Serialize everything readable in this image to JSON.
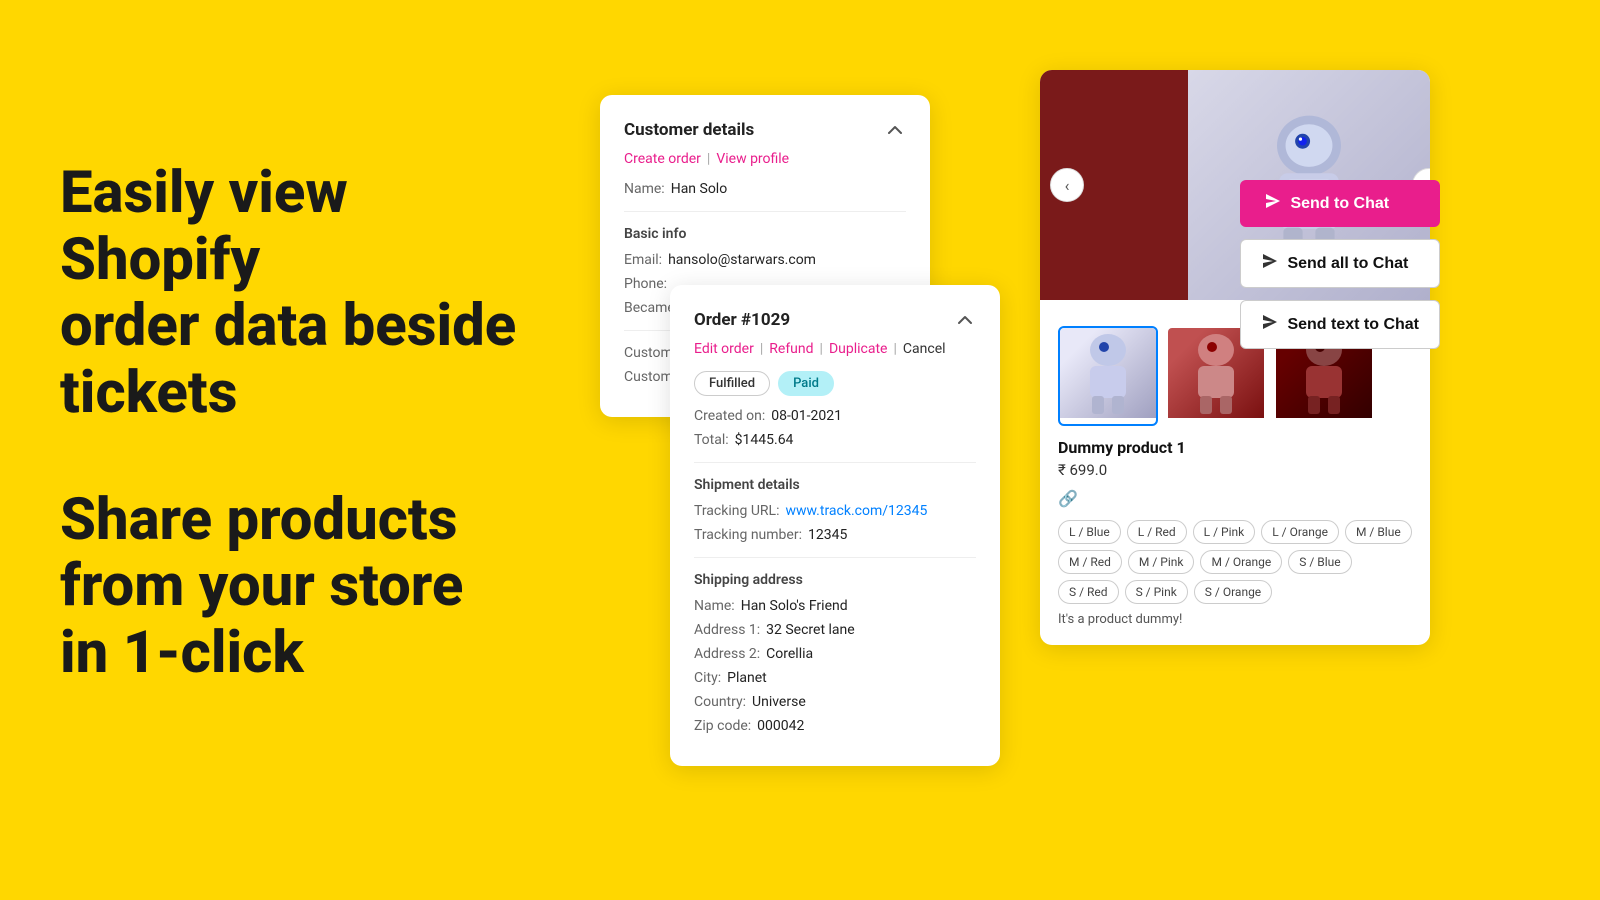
{
  "page": {
    "bg_color": "#FFD700"
  },
  "left": {
    "headline1": "Easily view Shopify",
    "headline2": "order data beside",
    "headline3": "tickets",
    "headline4": "Share products",
    "headline5": "from your store",
    "headline6": "in 1-click"
  },
  "customer_card": {
    "title": "Customer details",
    "action_create": "Create order",
    "action_view": "View profile",
    "name_label": "Name:",
    "name_value": "Han Solo",
    "basic_info_title": "Basic info",
    "email_label": "Email:",
    "email_value": "hansolo@starwars.com",
    "phone_label": "Phone:",
    "became_label": "Became",
    "custom_label1": "Custom",
    "custom_label2": "Custom"
  },
  "order_card": {
    "title": "Order #1029",
    "action_edit": "Edit order",
    "action_refund": "Refund",
    "action_duplicate": "Duplicate",
    "action_cancel": "Cancel",
    "badge_fulfilled": "Fulfilled",
    "badge_paid": "Paid",
    "created_label": "Created on:",
    "created_value": "08-01-2021",
    "total_label": "Total:",
    "total_value": "$1445.64",
    "shipment_title": "Shipment details",
    "tracking_url_label": "Tracking URL:",
    "tracking_url_value": "www.track.com/12345",
    "tracking_num_label": "Tracking number:",
    "tracking_num_value": "12345",
    "shipping_title": "Shipping address",
    "ship_name_label": "Name:",
    "ship_name_value": "Han Solo's Friend",
    "addr1_label": "Address 1:",
    "addr1_value": "32 Secret lane",
    "addr2_label": "Address 2:",
    "addr2_value": "Corellia",
    "city_label": "City:",
    "city_value": "Planet",
    "country_label": "Country:",
    "country_value": "Universe",
    "zip_label": "Zip code:",
    "zip_value": "000042"
  },
  "product_card": {
    "product_name": "Dummy product 1",
    "product_price": "₹ 699.0",
    "product_desc": "It's a product dummy!",
    "variants": [
      "L / Blue",
      "L / Red",
      "L / Pink",
      "L / Orange",
      "M / Blue",
      "M / Red",
      "M / Pink",
      "M / Orange",
      "S / Blue",
      "S / Red",
      "S / Pink",
      "S / Orange"
    ]
  },
  "chat_buttons": {
    "send_to_chat": "Send to Chat",
    "send_all_to_chat": "Send all to Chat",
    "send_text_to_chat": "Send text to Chat"
  }
}
